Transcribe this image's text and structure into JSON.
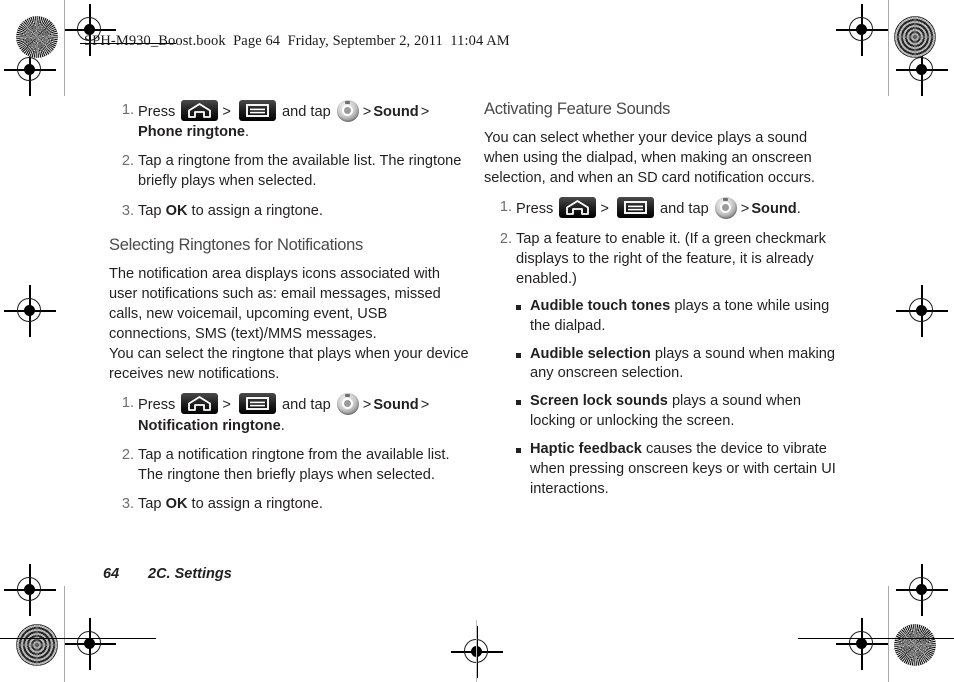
{
  "header": {
    "book_line": "SPH-M930_Boost.book  Page 64  Friday, September 2, 2011  11:04 AM"
  },
  "footer": {
    "page_number": "64",
    "section": "2C. Settings"
  },
  "icons": {
    "home": "home-key-icon",
    "menu": "menu-key-icon",
    "settings": "settings-gear-icon",
    "chevron": ">"
  },
  "left_column": {
    "steps_phone_ringtone": [
      {
        "num": "1.",
        "parts": {
          "press": "Press",
          "and_tap": "and tap",
          "sound": "Sound",
          "target": "Phone ringtone",
          "period": "."
        }
      },
      {
        "num": "2.",
        "text": "Tap a ringtone from the available list. The ringtone briefly plays when selected."
      },
      {
        "num": "3.",
        "text_before": "Tap ",
        "bold": "OK",
        "text_after": " to assign a ringtone."
      }
    ],
    "section_heading": "Selecting Ringtones for Notifications",
    "intro_paragraph": "The notification area displays icons associated with user notifications such as: email messages, missed calls, new voicemail, upcoming event, USB connections, SMS (text)/MMS messages.",
    "intro_paragraph_2": "You can select the ringtone that plays when your device receives new notifications.",
    "steps_notification_ringtone": [
      {
        "num": "1.",
        "parts": {
          "press": "Press",
          "and_tap": "and tap",
          "sound": "Sound",
          "target": "Notification ringtone",
          "period": "."
        }
      },
      {
        "num": "2.",
        "text": "Tap a notification ringtone from the available list. The ringtone then briefly plays when selected."
      },
      {
        "num": "3.",
        "text_before": "Tap ",
        "bold": "OK",
        "text_after": " to assign a ringtone."
      }
    ]
  },
  "right_column": {
    "section_heading": "Activating Feature Sounds",
    "intro_paragraph": "You can select whether your device plays a sound when using the dialpad, when making an onscreen selection, and when an SD card notification occurs.",
    "steps": [
      {
        "num": "1.",
        "parts": {
          "press": "Press",
          "and_tap": "and tap",
          "sound": "Sound",
          "period": "."
        }
      },
      {
        "num": "2.",
        "text": "Tap a feature to enable it. (If a green checkmark displays to the right of the feature, it is already enabled.)"
      }
    ],
    "bullets": [
      {
        "bold": "Audible touch tones",
        "text": " plays a tone while using the dialpad."
      },
      {
        "bold": "Audible selection",
        "text": " plays a sound when making any onscreen selection."
      },
      {
        "bold": "Screen lock sounds",
        "text": " plays a sound when locking or unlocking the screen."
      },
      {
        "bold": "Haptic feedback",
        "text": " causes the device to vibrate when pressing onscreen keys or with certain UI interactions."
      }
    ]
  }
}
